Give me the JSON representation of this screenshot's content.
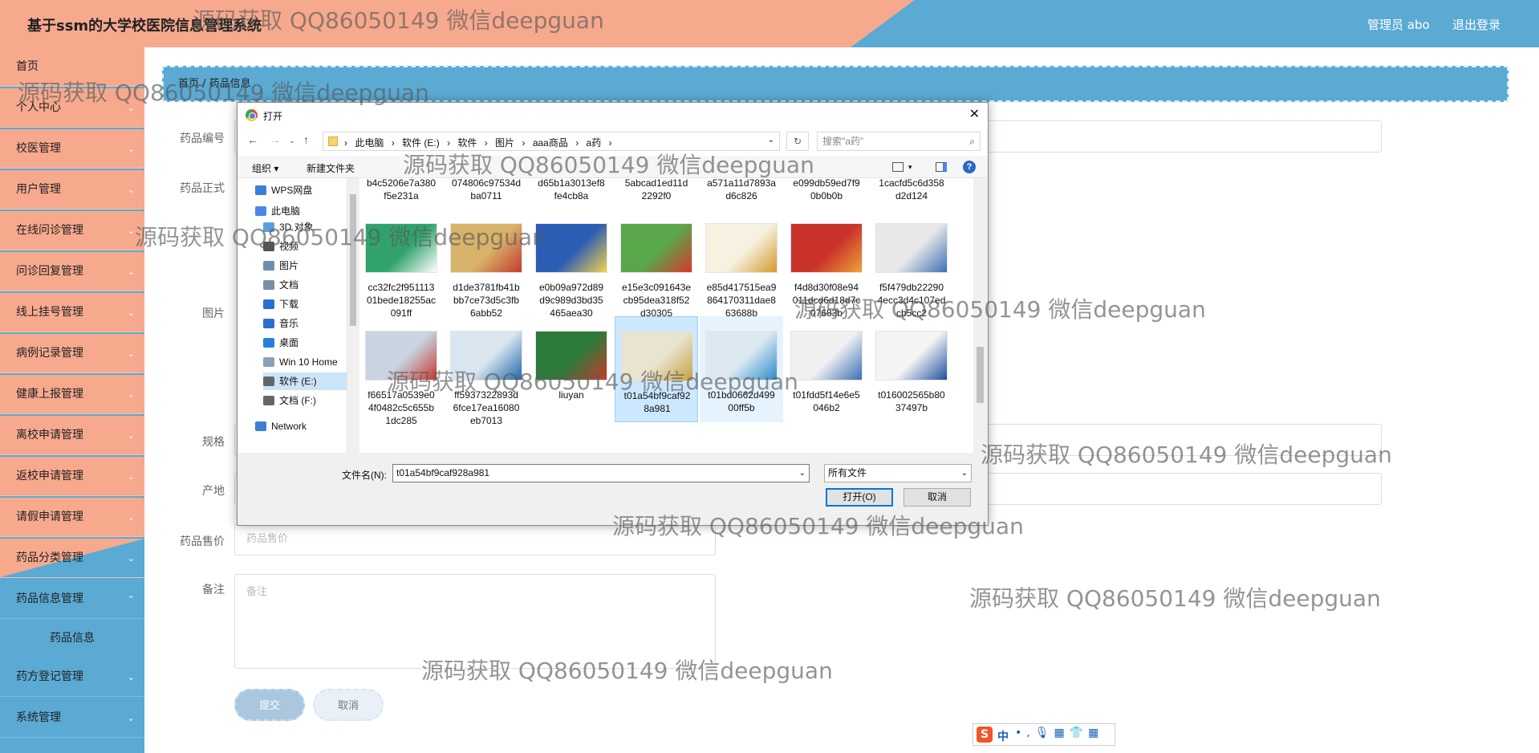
{
  "header": {
    "title": "基于ssm的大学校医院信息管理系统",
    "user_label": "管理员 abo",
    "logout_label": "退出登录"
  },
  "sidebar": {
    "items": [
      {
        "label": "首页"
      },
      {
        "label": "个人中心"
      },
      {
        "label": "校医管理"
      },
      {
        "label": "用户管理"
      },
      {
        "label": "在线问诊管理"
      },
      {
        "label": "问诊回复管理"
      },
      {
        "label": "线上挂号管理"
      },
      {
        "label": "病例记录管理"
      },
      {
        "label": "健康上报管理"
      },
      {
        "label": "离校申请管理"
      },
      {
        "label": "返校申请管理"
      },
      {
        "label": "请假申请管理"
      },
      {
        "label": "药品分类管理"
      },
      {
        "label": "药品信息管理"
      },
      {
        "label": "药品信息"
      },
      {
        "label": "药方登记管理"
      },
      {
        "label": "系统管理"
      }
    ]
  },
  "breadcrumb": {
    "home": "首页",
    "current": "药品信息"
  },
  "form": {
    "labels": {
      "code": "药品编号",
      "name": "药品正式",
      "image": "图片",
      "spec": "规格",
      "origin": "产地",
      "price": "药品售价",
      "remark": "备注"
    },
    "price_placeholder": "药品售价",
    "remark_placeholder": "备注",
    "submit_label": "提交",
    "cancel_label": "取消"
  },
  "dialog": {
    "title": "打开",
    "address_crumbs": [
      "此电脑",
      "软件 (E:)",
      "软件",
      "图片",
      "aaa商品",
      "a药"
    ],
    "search_placeholder": "搜索\"a药\"",
    "toolbar": {
      "organize": "组织 ▾",
      "new_folder": "新建文件夹"
    },
    "nav_items": [
      {
        "label": "WPS网盘",
        "icon": "cloud-icon",
        "color": "#3b7fd6"
      },
      {
        "label": "此电脑",
        "icon": "computer-icon",
        "color": "#4a86e8"
      },
      {
        "label": "3D 对象",
        "icon": "cube-icon",
        "color": "#5aa0e0"
      },
      {
        "label": "视频",
        "icon": "video-icon",
        "color": "#555"
      },
      {
        "label": "图片",
        "icon": "picture-icon",
        "color": "#6a8fb3"
      },
      {
        "label": "文档",
        "icon": "document-icon",
        "color": "#7a8fa3"
      },
      {
        "label": "下载",
        "icon": "download-icon",
        "color": "#2a6fd1"
      },
      {
        "label": "音乐",
        "icon": "music-icon",
        "color": "#2a6fd1"
      },
      {
        "label": "桌面",
        "icon": "desktop-icon",
        "color": "#2a7fd6"
      },
      {
        "label": "Win 10 Home",
        "icon": "drive-icon",
        "color": "#8aa0b3"
      },
      {
        "label": "软件 (E:)",
        "icon": "drive-icon",
        "color": "#666"
      },
      {
        "label": "文档 (F:)",
        "icon": "drive-icon",
        "color": "#666"
      },
      {
        "label": "Network",
        "icon": "network-icon",
        "color": "#3b7fd6"
      }
    ],
    "top_row": [
      "b4c5206e7a380\nf5e231a",
      "074806c97534d\nba0711",
      "d65b1a3013ef8\nfe4cb8a",
      "5abcad1ed11d\n2292f0",
      "a571a11d7893a\nd6c826",
      "e099db59ed7f9\n0b0b0b",
      "1cacfd5c6d358\nd2d124"
    ],
    "row2": [
      {
        "name": "cc32fc2f951113\n01bede18255ac\n091ff",
        "color": "#2fa36b",
        "accent": "#ffffff"
      },
      {
        "name": "d1de3781fb41b\nbb7ce73d5c3fb\n6abb52",
        "color": "#d8b36a",
        "accent": "#c33c2c"
      },
      {
        "name": "e0b09a972d89\nd9c989d3bd35\n465aea30",
        "color": "#2b5db5",
        "accent": "#f3d34a"
      },
      {
        "name": "e15e3c091643e\ncb95dea318f52\nd30305",
        "color": "#5aa64b",
        "accent": "#d9372b"
      },
      {
        "name": "e85d417515ea9\n864170311dae8\n63688b",
        "color": "#f6f1e0",
        "accent": "#d49a2a"
      },
      {
        "name": "f4d8d30f08e94\n011dcd6d18d7c\n07683b",
        "color": "#c9312b",
        "accent": "#f0a23a"
      },
      {
        "name": "f5f479db22290\n4ecc3d4c107ed\ncb5cc2",
        "color": "#e8e8e8",
        "accent": "#3a6fb5"
      }
    ],
    "row3": [
      {
        "name": "f66517a0539e0\n4f0482c5c655b\n1dc285",
        "color": "#c8d4e0",
        "accent": "#c7372c",
        "state": ""
      },
      {
        "name": "ff5937322893d\n6fce17ea16080\neb7013",
        "color": "#d9e6ef",
        "accent": "#1f67a8",
        "state": ""
      },
      {
        "name": "liuyan",
        "color": "#2d7a3a",
        "accent": "#c43b2a",
        "state": ""
      },
      {
        "name": "t01a54bf9caf92\n8a981",
        "color": "#e9e4cf",
        "accent": "#c5a340",
        "state": "sel"
      },
      {
        "name": "t01bd0662d499\n00ff5b",
        "color": "#dce9f2",
        "accent": "#2a8cc9",
        "state": "hov"
      },
      {
        "name": "t01fdd5f14e6e5\n046b2",
        "color": "#f0f0f0",
        "accent": "#3a6fb5",
        "state": ""
      },
      {
        "name": "t016002565b80\n37497b",
        "color": "#f4f4f4",
        "accent": "#1f4f9e",
        "state": ""
      }
    ],
    "filename_label": "文件名(N):",
    "filename_value": "t01a54bf9caf928a981",
    "filetype_value": "所有文件",
    "open_label": "打开(O)",
    "cancel_label": "取消"
  },
  "watermark": "源码获取 QQ86050149 微信deepguan",
  "ime": {
    "logo": "S",
    "lang": "中"
  }
}
